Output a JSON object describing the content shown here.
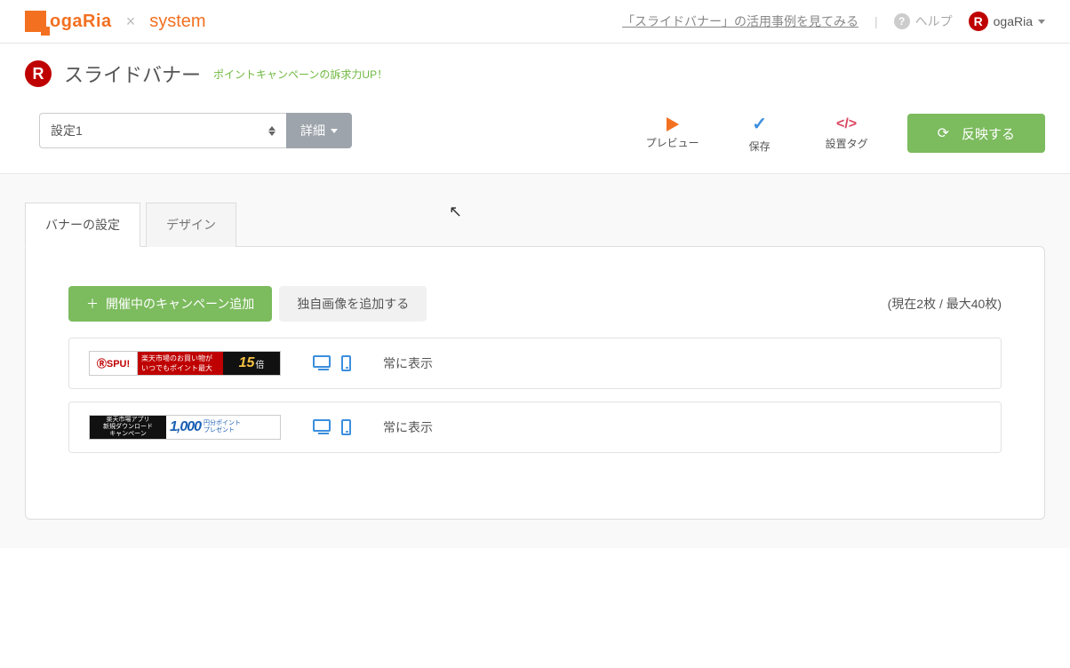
{
  "header": {
    "logo_main": "ogaRia",
    "logo_x": "×",
    "logo_sys": "system",
    "case_link": "「スライドバナー」の活用事例を見てみる",
    "divider": "|",
    "help_label": "ヘルプ",
    "user_name": "ogaRia"
  },
  "title": {
    "icon_letter": "R",
    "page_title": "スライドバナー",
    "promo": "ポイントキャンペーンの訴求力UP！"
  },
  "toolbar": {
    "select_value": "設定1",
    "detail_label": "詳細",
    "preview_label": "プレビュー",
    "save_label": "保存",
    "tag_label": "設置タグ",
    "apply_label": "反映する"
  },
  "tabs": {
    "banner_settings": "バナーの設定",
    "design": "デザイン"
  },
  "panel": {
    "add_campaign": "開催中のキャンペーン追加",
    "add_custom": "独自画像を追加する",
    "count": "(現在2枚 / 最大40枚)",
    "rows": [
      {
        "display": "常に表示",
        "thumb": {
          "type": "a",
          "label1": "ⓇSPU!",
          "label2": "楽天市場のお買い物が\nいつでもポイント最大",
          "num": "15",
          "unit": "倍"
        }
      },
      {
        "display": "常に表示",
        "thumb": {
          "type": "b",
          "line1": "楽天市場アプリ",
          "line2": "新規ダウンロード",
          "line3": "キャンペーン",
          "num": "1,000",
          "txt1": "円分ポイント",
          "txt2": "プレゼント"
        }
      }
    ]
  }
}
